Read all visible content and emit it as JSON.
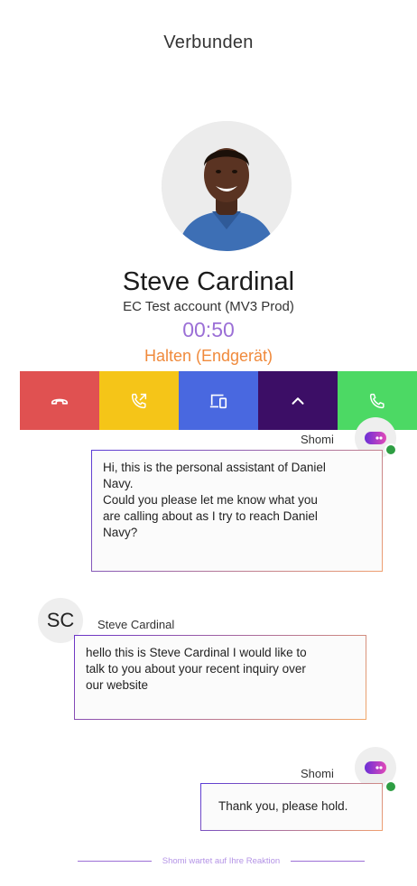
{
  "call": {
    "status": "Verbunden",
    "caller_name": "Steve Cardinal",
    "caller_account": "EC Test account (MV3 Prod)",
    "timer": "00:50",
    "state": "Halten (Endgerät)"
  },
  "action_bar": {
    "buttons": [
      {
        "name": "hangup",
        "icon": "phone-hangup-icon",
        "color": "#e05151"
      },
      {
        "name": "transfer",
        "icon": "phone-forward-icon",
        "color": "#f5c518"
      },
      {
        "name": "device",
        "icon": "devices-icon",
        "color": "#4968e0"
      },
      {
        "name": "more",
        "icon": "chevron-up-icon",
        "color": "#3c0e66"
      },
      {
        "name": "accept",
        "icon": "phone-icon",
        "color": "#4cd964"
      }
    ]
  },
  "chat": {
    "messages": [
      {
        "sender": "Shomi",
        "role": "bot",
        "lines": [
          "Hi, this is the personal assistant of Daniel",
          "Navy.",
          "Could you please let me know what you",
          "are calling about as I try to reach Daniel",
          "Navy?"
        ]
      },
      {
        "sender": "Steve Cardinal",
        "role": "user",
        "initials": "SC",
        "lines": [
          "hello this is Steve Cardinal I would like to",
          "talk to you about your recent inquiry over",
          "our website"
        ]
      },
      {
        "sender": "Shomi",
        "role": "bot",
        "lines": [
          "Thank you, please hold."
        ]
      }
    ],
    "waiting_text": "Shomi wartet auf Ihre Reaktion"
  },
  "colors": {
    "accent_purple": "#9b6fd6",
    "hold_orange": "#f08a3c",
    "online_green": "#2e9e43"
  }
}
